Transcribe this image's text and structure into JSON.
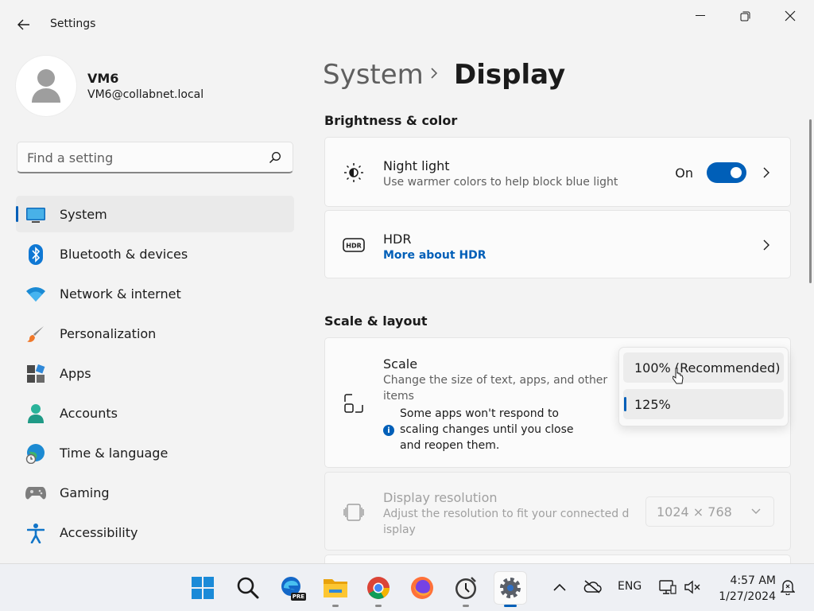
{
  "window": {
    "app_title": "Settings",
    "back_icon": "back-arrow-icon",
    "controls": [
      "minimize-icon",
      "maximize-icon",
      "close-icon"
    ]
  },
  "user": {
    "name": "VM6",
    "email": "VM6@collabnet.local"
  },
  "search": {
    "placeholder": "Find a setting"
  },
  "sidebar": {
    "items": [
      {
        "label": "System",
        "icon": "system-icon",
        "active": true
      },
      {
        "label": "Bluetooth & devices",
        "icon": "bluetooth-icon"
      },
      {
        "label": "Network & internet",
        "icon": "wifi-icon"
      },
      {
        "label": "Personalization",
        "icon": "brush-icon"
      },
      {
        "label": "Apps",
        "icon": "apps-icon"
      },
      {
        "label": "Accounts",
        "icon": "accounts-icon"
      },
      {
        "label": "Time & language",
        "icon": "globe-clock-icon"
      },
      {
        "label": "Gaming",
        "icon": "gamepad-icon"
      },
      {
        "label": "Accessibility",
        "icon": "accessibility-icon"
      }
    ]
  },
  "breadcrumb": {
    "parent": "System",
    "current": "Display"
  },
  "sections": {
    "brightness": {
      "title": "Brightness & color",
      "night_light": {
        "title": "Night light",
        "desc": "Use warmer colors to help block blue light",
        "state": "On"
      },
      "hdr": {
        "title": "HDR",
        "link": "More about HDR"
      }
    },
    "scale_layout": {
      "title": "Scale & layout",
      "scale": {
        "title": "Scale",
        "desc": "Change the size of text, apps, and other items",
        "info": "Some apps won't respond to scaling changes until you close and reopen them.",
        "options": [
          "100% (Recommended)",
          "125%"
        ],
        "selected": "125%"
      },
      "resolution": {
        "title": "Display resolution",
        "desc": "Adjust the resolution to fit your connected d isplay",
        "value": "1024 × 768"
      }
    }
  },
  "taskbar": {
    "apps": [
      "start-icon",
      "search-icon",
      "edge-pre-icon",
      "file-explorer-icon",
      "chrome-icon",
      "firefox-icon",
      "clock-app-icon",
      "settings-icon"
    ],
    "edge_badge": "PRE",
    "language": "ENG",
    "time": "4:57 AM",
    "date": "1/27/2024"
  },
  "colors": {
    "accent": "#005fb8",
    "background": "#f3f3f3",
    "card": "#fbfbfb"
  }
}
